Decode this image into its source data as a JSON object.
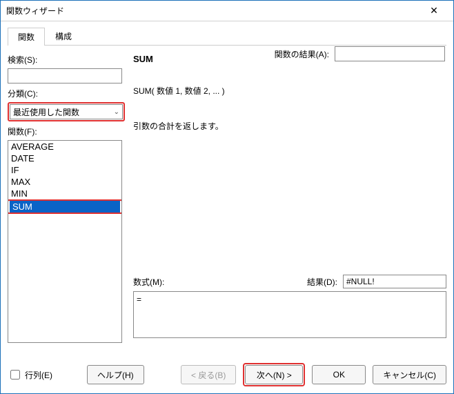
{
  "window": {
    "title": "関数ウィザード"
  },
  "tabs": {
    "functions": "関数",
    "structure": "構成"
  },
  "resultRow": {
    "label": "関数の結果(A):",
    "value": ""
  },
  "left": {
    "searchLabel": "検索(S):",
    "searchValue": "",
    "categoryLabel": "分類(C):",
    "categoryValue": "最近使用した関数",
    "funcLabel": "関数(F):",
    "items": [
      "AVERAGE",
      "DATE",
      "IF",
      "MAX",
      "MIN",
      "SUM"
    ],
    "selected": "SUM"
  },
  "right": {
    "funcName": "SUM",
    "syntax": "SUM( 数値 1, 数値 2, ...  )",
    "description": "引数の合計を返します。",
    "formulaLabel": "数式(M):",
    "resultLabel": "結果(D):",
    "resultValue": "#NULL!",
    "formulaValue": "="
  },
  "bottom": {
    "matrixLabel": "行列(E)",
    "help": "ヘルプ(H)",
    "back": "< 戻る(B)",
    "next": "次へ(N) >",
    "ok": "OK",
    "cancel": "キャンセル(C)"
  }
}
